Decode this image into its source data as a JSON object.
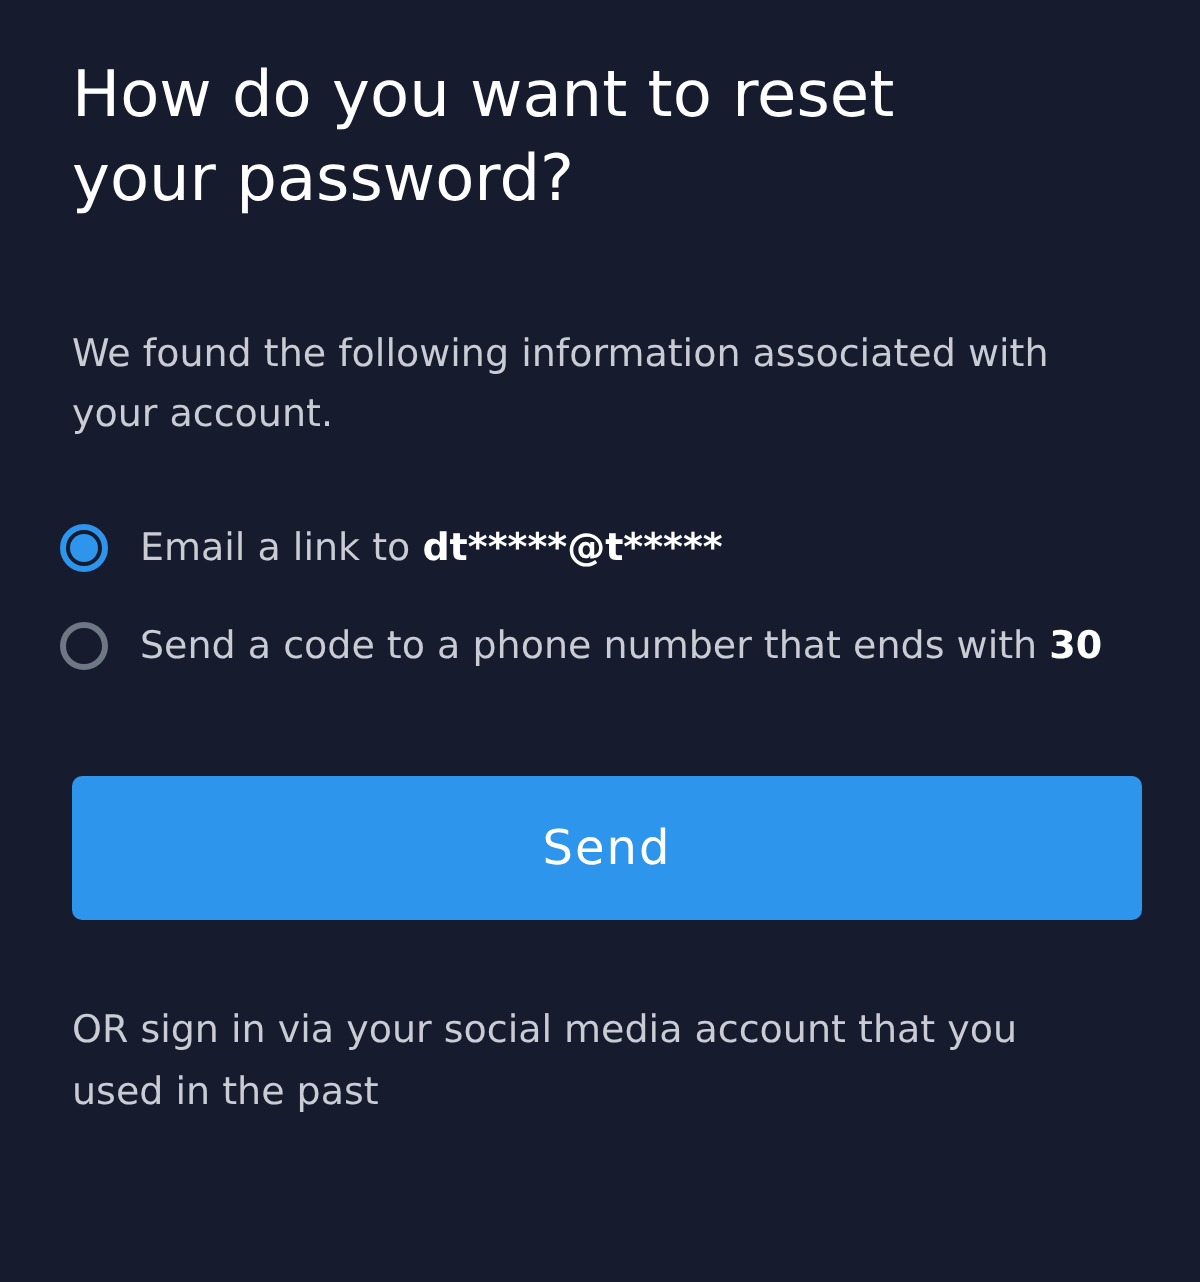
{
  "title": "How do you want to reset your password?",
  "intro": "We found the following information associated with your account.",
  "options": [
    {
      "label": "Email a link to",
      "detail": "dt*****@t*****",
      "selected": true
    },
    {
      "label": "Send a code to a phone number that ends with",
      "detail": "30",
      "selected": false
    }
  ],
  "button": "Send",
  "footer": "OR sign in via your social media account that you used in the past"
}
